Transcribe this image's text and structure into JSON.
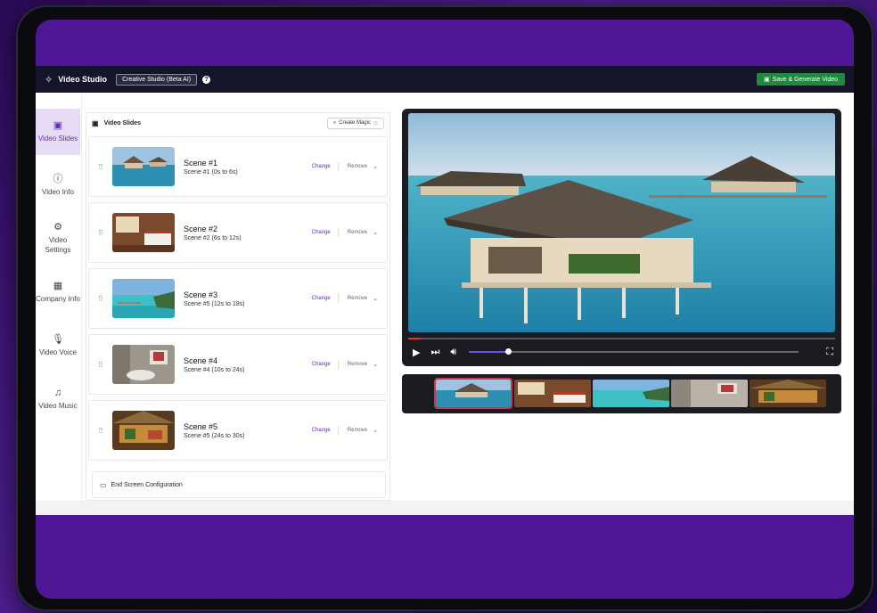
{
  "topbar": {
    "title": "Video Studio",
    "studio_pill": "Creative Studio (Beta AI)",
    "help": "?",
    "save_button": "Save & Generate Video"
  },
  "sidebar": {
    "items": [
      {
        "label": "Video Slides",
        "icon": "monitor-icon",
        "active": true
      },
      {
        "label": "Video Info",
        "icon": "info-icon",
        "active": false
      },
      {
        "label": "Video Settings",
        "icon": "gear-icon",
        "active": false
      },
      {
        "label": "Company Info",
        "icon": "building-icon",
        "active": false
      },
      {
        "label": "Video Voice",
        "icon": "microphone-icon",
        "active": false
      },
      {
        "label": "Video Music",
        "icon": "music-note-icon",
        "active": false
      }
    ]
  },
  "slides_panel": {
    "header": "Video Slides",
    "magic_button": "Create Magic",
    "change_label": "Change",
    "remove_label": "Remove",
    "scenes": [
      {
        "title": "Scene #1",
        "subtitle": "Scene #1 (0s to 6s)"
      },
      {
        "title": "Scene #2",
        "subtitle": "Scene #2 (6s to 12s)"
      },
      {
        "title": "Scene #3",
        "subtitle": "Scene #5 (12s to 18s)"
      },
      {
        "title": "Scene #4",
        "subtitle": "Scene #4 (10s to 24s)"
      },
      {
        "title": "Scene #5",
        "subtitle": "Scene #5 (24s to 30s)"
      }
    ],
    "end_screen": "End Screen Configuration"
  },
  "player": {
    "progress_fraction": 0.03,
    "volume_fraction": 0.12
  },
  "colors": {
    "accent": "#6a2cb8",
    "save_green": "#1f8a3c",
    "topbar": "#14142a",
    "frame_purple": "#4f1796"
  }
}
